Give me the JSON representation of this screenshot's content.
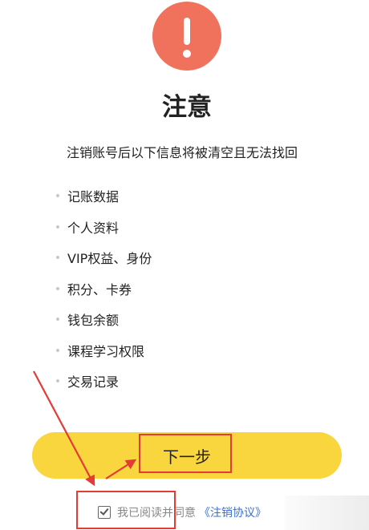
{
  "notice": {
    "title": "注意",
    "subtitle": "注销账号后以下信息将被清空且无法找回"
  },
  "items": [
    {
      "label": "记账数据"
    },
    {
      "label": "个人资料"
    },
    {
      "label": "VIP权益、身份"
    },
    {
      "label": "积分、卡券"
    },
    {
      "label": "钱包余额"
    },
    {
      "label": "课程学习权限"
    },
    {
      "label": "交易记录"
    }
  ],
  "next_button": {
    "label": "下一步"
  },
  "agreement": {
    "checked": true,
    "text": "我已阅读并同意",
    "link": "《注销协议》"
  },
  "colors": {
    "warning": "#f1725c",
    "button": "#f9d63e",
    "link": "#3a6fd3",
    "annotation": "#e33b36"
  },
  "icons": [
    "exclamation-icon",
    "checkbox-checked-icon"
  ]
}
